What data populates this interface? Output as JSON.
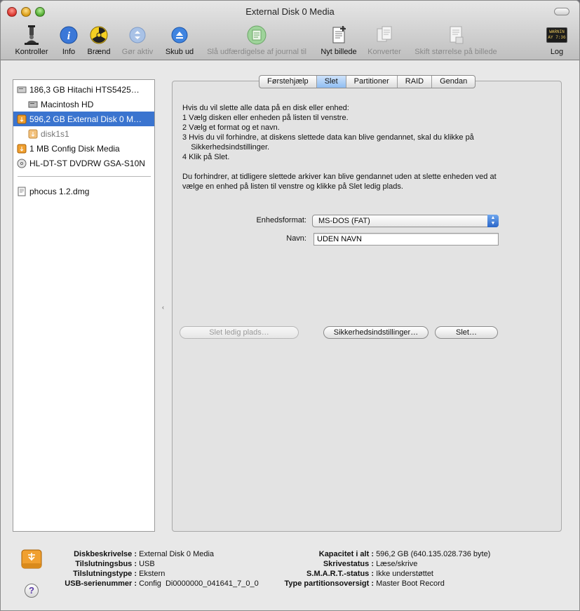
{
  "window": {
    "title": "External Disk 0 Media"
  },
  "toolbar": [
    {
      "label": "Kontroller",
      "icon": "microscope-icon",
      "disabled": false
    },
    {
      "label": "Info",
      "icon": "info-icon",
      "disabled": false
    },
    {
      "label": "Brænd",
      "icon": "burn-icon",
      "disabled": false
    },
    {
      "label": "Gør aktiv",
      "icon": "mount-icon",
      "disabled": true
    },
    {
      "label": "Skub ud",
      "icon": "eject-icon",
      "disabled": false
    },
    {
      "label": "Slå udfærdigelse af journal til",
      "icon": "journal-icon",
      "disabled": true
    },
    {
      "label": "Nyt billede",
      "icon": "new-image-icon",
      "disabled": false
    },
    {
      "label": "Konverter",
      "icon": "convert-icon",
      "disabled": true
    },
    {
      "label": "Skift størrelse på billede",
      "icon": "resize-image-icon",
      "disabled": true
    },
    {
      "label": "Log",
      "icon": "log-icon",
      "disabled": false
    }
  ],
  "log_icon_text": {
    "line1": "WARNIN",
    "line2": "AY 7:36"
  },
  "sidebar": {
    "items": [
      {
        "label": "186,3 GB Hitachi HTS5425…",
        "icon": "hard-disk-icon",
        "indent": 0,
        "selected": false,
        "dim": false
      },
      {
        "label": "Macintosh HD",
        "icon": "volume-icon",
        "indent": 1,
        "selected": false,
        "dim": false
      },
      {
        "label": "596,2 GB External Disk 0 M…",
        "icon": "external-disk-icon",
        "indent": 0,
        "selected": true,
        "dim": false
      },
      {
        "label": "disk1s1",
        "icon": "external-volume-icon",
        "indent": 1,
        "selected": false,
        "dim": true
      },
      {
        "label": "1 MB Config Disk Media",
        "icon": "external-disk-icon",
        "indent": 0,
        "selected": false,
        "dim": false
      },
      {
        "label": "HL-DT-ST DVDRW GSA-S10N",
        "icon": "optical-drive-icon",
        "indent": 0,
        "selected": false,
        "dim": false
      },
      {
        "label": "phocus 1.2.dmg",
        "icon": "dmg-file-icon",
        "indent": 0,
        "selected": false,
        "dim": false
      }
    ]
  },
  "tabs": [
    {
      "label": "Førstehjælp",
      "active": false
    },
    {
      "label": "Slet",
      "active": true
    },
    {
      "label": "Partitioner",
      "active": false
    },
    {
      "label": "RAID",
      "active": false
    },
    {
      "label": "Gendan",
      "active": false
    }
  ],
  "instructions": {
    "lines": [
      "Hvis du vil slette alle data på en disk eller enhed:",
      "1  Vælg disken eller enheden på listen til venstre.",
      "2  Vælg et format og et navn.",
      "3  Hvis du vil forhindre, at diskens slettede data kan blive gendannet, skal du klikke på",
      "    Sikkerhedsindstillinger.",
      "4  Klik på Slet."
    ],
    "note_lines": [
      "Du forhindrer, at tidligere slettede arkiver kan blive gendannet uden at slette enheden ved at",
      "vælge en enhed på listen til venstre og klikke på Slet ledig plads."
    ]
  },
  "form": {
    "format_label": "Enhedsformat:",
    "format_value": "MS-DOS (FAT)",
    "name_label": "Navn:",
    "name_value": "UDEN NAVN"
  },
  "buttons": {
    "erase_free_space": "Slet ledig plads…",
    "security_options": "Sikkerhedsindstillinger…",
    "erase": "Slet…"
  },
  "info": {
    "left": [
      {
        "key": "Diskbeskrivelse :",
        "value": "External Disk 0 Media"
      },
      {
        "key": "Tilslutningsbus :",
        "value": "USB"
      },
      {
        "key": "Tilslutningstype :",
        "value": "Ekstern"
      },
      {
        "key": "USB-serienummer :",
        "value": "Config  Di0000000_041641_7_0_0"
      }
    ],
    "right": [
      {
        "key": "Kapacitet i alt :",
        "value": "596,2 GB (640.135.028.736 byte)"
      },
      {
        "key": "Skrivestatus :",
        "value": "Læse/skrive"
      },
      {
        "key": "S.M.A.R.T.-status :",
        "value": "Ikke understøttet"
      },
      {
        "key": "Type partitionsoversigt :",
        "value": "Master Boot Record"
      }
    ]
  },
  "colors": {
    "selection": "#3a74cf",
    "accent_blue": "#2a66c8"
  }
}
